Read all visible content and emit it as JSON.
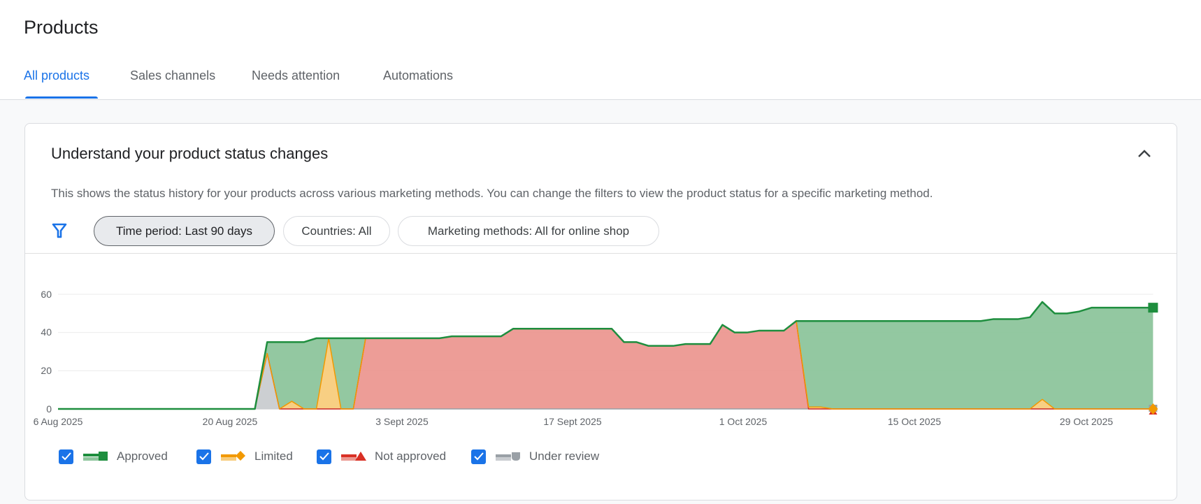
{
  "header": {
    "title": "Products",
    "tabs": [
      {
        "label": "All products",
        "active": true
      },
      {
        "label": "Sales channels",
        "active": false
      },
      {
        "label": "Needs attention",
        "active": false
      },
      {
        "label": "Automations",
        "active": false
      }
    ]
  },
  "card": {
    "title": "Understand your product status changes",
    "description": "This shows the status history for your products across various marketing methods. You can change the filters to view the product status for a specific marketing method.",
    "collapse_icon": "chevron-up-icon",
    "filter_icon": "filter-icon",
    "filters": [
      {
        "label": "Time period: Last 90 days",
        "selected": true
      },
      {
        "label": "Countries: All",
        "selected": false
      },
      {
        "label": "Marketing methods: All for online shop",
        "selected": false
      }
    ]
  },
  "chart_data": {
    "type": "area",
    "stacked": true,
    "grid": true,
    "ylim": [
      0,
      60
    ],
    "y_ticks": [
      "0",
      "20",
      "40",
      "60"
    ],
    "x_ticks": [
      "6 Aug 2025",
      "20 Aug 2025",
      "3 Sept 2025",
      "17 Sept 2025",
      "1 Oct 2025",
      "15 Oct 2025",
      "29 Oct 2025"
    ],
    "x_tick_dates": [
      "2025-08-06",
      "2025-08-20",
      "2025-09-03",
      "2025-09-17",
      "2025-10-01",
      "2025-10-15",
      "2025-10-29"
    ],
    "x_range": [
      "2025-08-06",
      "2025-11-03"
    ],
    "legend_position": "bottom-left",
    "series": [
      {
        "name": "Under review",
        "color": "#9aa0a6",
        "fill": "#c9ccd0",
        "marker": "shield",
        "values": [
          0,
          0,
          0,
          0,
          0,
          0,
          0,
          0,
          0,
          0,
          0,
          0,
          0,
          0,
          0,
          0,
          0,
          29,
          0,
          0,
          0,
          0,
          0,
          0,
          0,
          0,
          0,
          0,
          0,
          0,
          0,
          0,
          0,
          0,
          0,
          0,
          0,
          0,
          0,
          0,
          0,
          0,
          0,
          0,
          0,
          0,
          0,
          0,
          0,
          0,
          0,
          0,
          0,
          0,
          0,
          0,
          0,
          0,
          0,
          0,
          0,
          0,
          0,
          0,
          0,
          0,
          0,
          0,
          0,
          0,
          0,
          0,
          0,
          0,
          0,
          0,
          0,
          0,
          0,
          0,
          0,
          0,
          0,
          0,
          0,
          0,
          0,
          0,
          0,
          0
        ]
      },
      {
        "name": "Not approved",
        "color": "#d93025",
        "fill": "#ec9891",
        "marker": "triangle",
        "values": [
          0,
          0,
          0,
          0,
          0,
          0,
          0,
          0,
          0,
          0,
          0,
          0,
          0,
          0,
          0,
          0,
          0,
          0,
          0,
          0,
          0,
          0,
          0,
          0,
          0,
          37,
          37,
          37,
          37,
          37,
          37,
          37,
          38,
          38,
          38,
          38,
          38,
          42,
          42,
          42,
          42,
          42,
          42,
          42,
          42,
          42,
          35,
          35,
          33,
          33,
          33,
          34,
          34,
          34,
          44,
          40,
          40,
          41,
          41,
          41,
          46,
          0,
          0,
          0,
          0,
          0,
          0,
          0,
          0,
          0,
          0,
          0,
          0,
          0,
          0,
          0,
          0,
          0,
          0,
          0,
          0,
          0,
          0,
          0,
          0,
          0,
          0,
          0,
          0,
          0
        ]
      },
      {
        "name": "Limited",
        "color": "#f29900",
        "fill": "#f8cc7c",
        "marker": "diamond",
        "values": [
          0,
          0,
          0,
          0,
          0,
          0,
          0,
          0,
          0,
          0,
          0,
          0,
          0,
          0,
          0,
          0,
          0,
          0,
          0,
          4,
          0,
          0,
          37,
          0,
          0,
          0,
          0,
          0,
          0,
          0,
          0,
          0,
          0,
          0,
          0,
          0,
          0,
          0,
          0,
          0,
          0,
          0,
          0,
          0,
          0,
          0,
          0,
          0,
          0,
          0,
          0,
          0,
          0,
          0,
          0,
          0,
          0,
          0,
          0,
          0,
          0,
          1,
          1,
          0,
          0,
          0,
          0,
          0,
          0,
          0,
          0,
          0,
          0,
          0,
          0,
          0,
          0,
          0,
          0,
          0,
          5,
          0,
          0,
          0,
          0,
          0,
          0,
          0,
          0,
          0
        ]
      },
      {
        "name": "Approved",
        "color": "#1e8e3e",
        "fill": "#8dc59c",
        "marker": "square",
        "values": [
          0,
          0,
          0,
          0,
          0,
          0,
          0,
          0,
          0,
          0,
          0,
          0,
          0,
          0,
          0,
          0,
          0,
          6,
          35,
          31,
          35,
          37,
          0,
          37,
          37,
          0,
          0,
          0,
          0,
          0,
          0,
          0,
          0,
          0,
          0,
          0,
          0,
          0,
          0,
          0,
          0,
          0,
          0,
          0,
          0,
          0,
          0,
          0,
          0,
          0,
          0,
          0,
          0,
          0,
          0,
          0,
          0,
          0,
          0,
          0,
          0,
          45,
          45,
          46,
          46,
          46,
          46,
          46,
          46,
          46,
          46,
          46,
          46,
          46,
          46,
          46,
          47,
          47,
          47,
          48,
          51,
          50,
          50,
          51,
          53,
          53,
          53,
          53,
          53,
          53
        ]
      }
    ]
  },
  "legend": [
    {
      "label": "Approved",
      "checked": true,
      "color": "#1e8e3e"
    },
    {
      "label": "Limited",
      "checked": true,
      "color": "#f29900"
    },
    {
      "label": "Not approved",
      "checked": true,
      "color": "#d93025"
    },
    {
      "label": "Under review",
      "checked": true,
      "color": "#9aa0a6"
    }
  ]
}
